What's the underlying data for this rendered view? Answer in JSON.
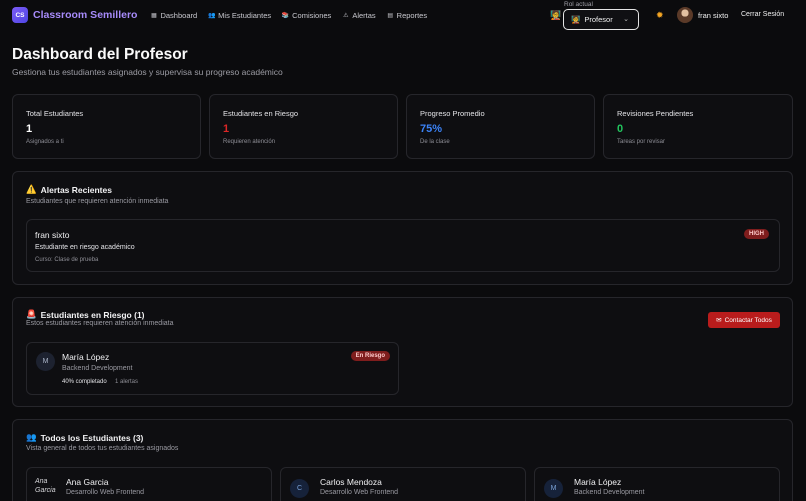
{
  "nav": {
    "brand": "Classroom Semillero",
    "logo_text": "CS",
    "items": [
      {
        "label": "Dashboard",
        "icon": "chart-icon"
      },
      {
        "label": "Mis Estudiantes",
        "icon": "users-icon"
      },
      {
        "label": "Comisiones",
        "icon": "book-icon"
      },
      {
        "label": "Alertas",
        "icon": "warning-icon"
      },
      {
        "label": "Reportes",
        "icon": "report-icon"
      }
    ],
    "role_caption": "Rol actual",
    "role_value": "Profesor",
    "user_name": "fran sixto",
    "logout": "Cerrar Sesión"
  },
  "header": {
    "title": "Dashboard del Profesor",
    "subtitle": "Gestiona tus estudiantes asignados y supervisa su progreso académico"
  },
  "stats": [
    {
      "title": "Total Estudiantes",
      "value": "1",
      "note": "Asignados a ti",
      "color": "#ffffff"
    },
    {
      "title": "Estudiantes en Riesgo",
      "value": "1",
      "note": "Requieren atención",
      "color": "#dc2626"
    },
    {
      "title": "Progreso Promedio",
      "value": "75%",
      "note": "De la clase",
      "color": "#3b82f6"
    },
    {
      "title": "Revisiones Pendientes",
      "value": "0",
      "note": "Tareas por revisar",
      "color": "#22c55e"
    }
  ],
  "alerts": {
    "title": "Alertas Recientes",
    "subtitle": "Estudiantes que requieren atención inmediata",
    "item": {
      "student": "fran sixto",
      "priority": "HIGH",
      "message": "Estudiante en riesgo académico",
      "course": "Curso: Clase de prueba"
    }
  },
  "at_risk": {
    "title": "Estudiantes en Riesgo (1)",
    "subtitle": "Estos estudiantes requieren atención inmediata",
    "contact_all": "Contactar Todos",
    "student": {
      "initial": "M",
      "name": "María López",
      "course": "Backend Development",
      "badge": "En Riesgo",
      "progress": "40% completado",
      "alerts": "1 alertas"
    }
  },
  "all_students": {
    "title": "Todos los Estudiantes (3)",
    "subtitle": "Vista general de todos tus estudiantes asignados",
    "students": [
      {
        "initial": "Ana Garcia",
        "name": "Ana Garcia",
        "course": "Desarrollo Web Frontend"
      },
      {
        "initial": "C",
        "name": "Carlos Mendoza",
        "course": "Desarrollo Web Frontend"
      },
      {
        "initial": "M",
        "name": "María López",
        "course": "Backend Development"
      }
    ]
  }
}
